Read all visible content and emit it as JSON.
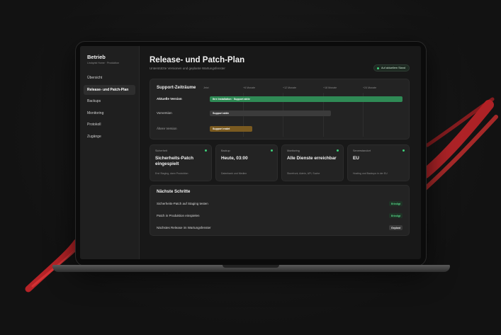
{
  "sidebar": {
    "title": "Betrieb",
    "subtitle": "Lindqvist Home · Produktion",
    "items": [
      {
        "label": "Übersicht",
        "active": false
      },
      {
        "label": "Release- und Patch-Plan",
        "active": true
      },
      {
        "label": "Backups",
        "active": false
      },
      {
        "label": "Monitoring",
        "active": false
      },
      {
        "label": "Protokoll",
        "active": false
      },
      {
        "label": "Zugänge",
        "active": false
      }
    ]
  },
  "header": {
    "title": "Release- und Patch-Plan",
    "subtitle": "Unterstützte Versionen und geplante Wartungsfenster",
    "status": "Auf aktuellem Stand"
  },
  "timeline": {
    "title": "Support-Zeiträume",
    "ticks": [
      "Jetzt",
      "+6 Monate",
      "+12 Monate",
      "+18 Monate",
      "+24 Monate"
    ],
    "rows": [
      {
        "label": "Aktuelle Version",
        "bar_label": "Ihre Installation · Support aktiv",
        "color": "#2f8a55",
        "start": 0,
        "end": 1.0
      },
      {
        "label": "Vorversion",
        "bar_label": "Support aktiv",
        "color": "#3b3b3b",
        "start": 0,
        "end": 0.63
      },
      {
        "label": "Ältere Version",
        "bar_label": "Support endet",
        "color": "#7a5a20",
        "start": 0,
        "end": 0.22
      }
    ]
  },
  "tiles": [
    {
      "label": "Sicherheit",
      "value": "Sicherheits-Patch eingespielt",
      "note": "Erst Staging, dann Produktion"
    },
    {
      "label": "Backup",
      "value": "Heute, 03:00",
      "note": "Datenbank und Medien"
    },
    {
      "label": "Monitoring",
      "value": "Alle Dienste erreichbar",
      "note": "Storefront, Admin, API, Suche"
    },
    {
      "label": "Serverstandort",
      "value": "EU",
      "note": "Hosting und Backups in der EU"
    }
  ],
  "steps": {
    "title": "Nächste Schritte",
    "items": [
      {
        "text": "Sicherheits-Patch auf Staging testen",
        "badge": "Erledigt",
        "state": "done"
      },
      {
        "text": "Patch in Produktion einspielen",
        "badge": "Erledigt",
        "state": "done"
      },
      {
        "text": "Nächstes Release im Wartungsfenster",
        "badge": "Geplant",
        "state": "planned"
      }
    ]
  },
  "colors": {
    "accent_green": "#3ecf7a",
    "brush_red": "#d42a2a"
  }
}
